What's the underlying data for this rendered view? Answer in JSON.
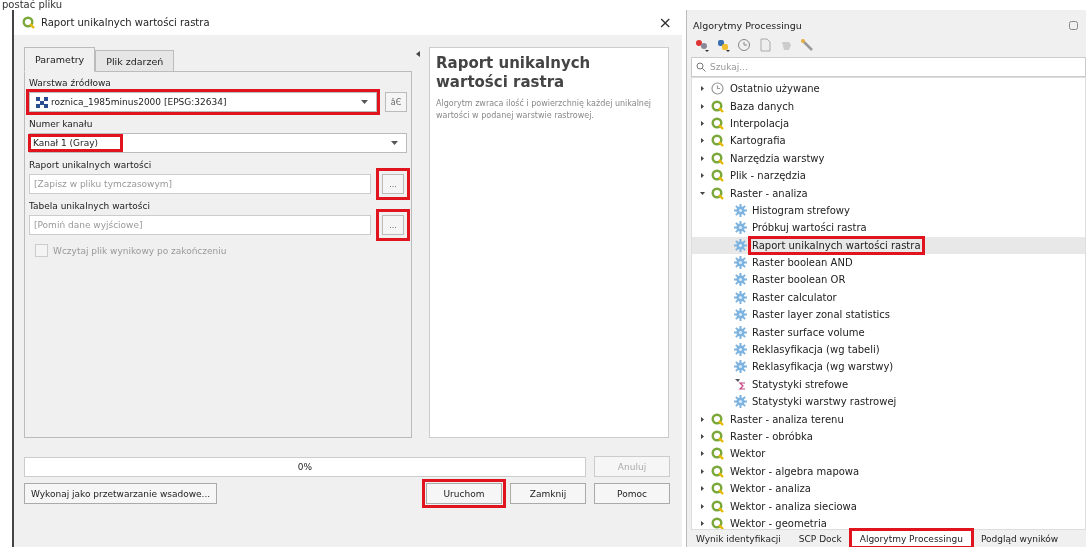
{
  "caption": "postać pliku",
  "dialog": {
    "title": "Raport unikalnych wartości rastra",
    "close": "×",
    "tabs": [
      {
        "label": "Parametry",
        "selected": true
      },
      {
        "label": "Plik zdarzeń",
        "selected": false
      }
    ],
    "params": [
      {
        "kind": "layer",
        "label": "Warstwa źródłowa",
        "value": "roznica_1985minus2000 [EPSG:32634]",
        "side_button": "âЄ",
        "highlighted": true
      },
      {
        "kind": "band",
        "label": "Numer kanału",
        "value": "Kanał 1 (Gray)",
        "highlighted": true
      },
      {
        "kind": "file",
        "label": "Raport unikalnych wartości",
        "placeholder": "[Zapisz w pliku tymczasowym]",
        "side_button": "...",
        "highlighted": true
      },
      {
        "kind": "file",
        "label": "Tabela unikalnych wartości",
        "placeholder": "[Pomiń dane wyjściowe]",
        "side_button": "...",
        "highlighted": true
      },
      {
        "kind": "check",
        "label": "Wczytaj plik wynikowy po zakończeniu",
        "checked": false,
        "disabled": true
      }
    ],
    "help": {
      "title": "Raport unikalnych wartości rastra",
      "text": "Algorytm zwraca ilość i powierzchnię każdej unikalnej wartości w podanej warstwie rastrowej."
    },
    "progress": {
      "level": 0,
      "reading": "0%"
    },
    "cancel": {
      "label": "Anuluj",
      "disabled": true
    },
    "batch_button": "Wykonaj jako przetwarzanie wsadowe...",
    "buttons": [
      {
        "label": "Uruchom",
        "highlighted": true
      },
      {
        "label": "Zamknij",
        "highlighted": false
      },
      {
        "label": "Pomoc",
        "highlighted": false
      }
    ]
  },
  "panel": {
    "title": "Algorytmy Processingu",
    "search": {
      "placeholder": "Szukaj..."
    },
    "tree": [
      {
        "label": "Ostatnio używane",
        "kind": "recent",
        "expanded": false
      },
      {
        "label": "Baza danych",
        "kind": "provider",
        "expanded": false
      },
      {
        "label": "Interpolacja",
        "kind": "provider",
        "expanded": false
      },
      {
        "label": "Kartografia",
        "kind": "provider",
        "expanded": false
      },
      {
        "label": "Narzędzia warstwy",
        "kind": "provider",
        "expanded": false
      },
      {
        "label": "Plik - narzędzia",
        "kind": "provider",
        "expanded": false
      },
      {
        "label": "Raster - analiza",
        "kind": "provider",
        "expanded": true,
        "children": [
          {
            "label": "Histogram strefowy",
            "kind": "algorithm",
            "selected": false
          },
          {
            "label": "Próbkuj wartości rastra",
            "kind": "algorithm",
            "selected": false
          },
          {
            "label": "Raport unikalnych wartości rastra",
            "kind": "algorithm",
            "selected": true,
            "highlighted": true
          },
          {
            "label": "Raster boolean AND",
            "kind": "algorithm",
            "selected": false
          },
          {
            "label": "Raster boolean OR",
            "kind": "algorithm",
            "selected": false
          },
          {
            "label": "Raster calculator",
            "kind": "algorithm",
            "selected": false
          },
          {
            "label": "Raster layer zonal statistics",
            "kind": "algorithm",
            "selected": false
          },
          {
            "label": "Raster surface volume",
            "kind": "algorithm",
            "selected": false
          },
          {
            "label": "Reklasyfikacja (wg tabeli)",
            "kind": "algorithm",
            "selected": false
          },
          {
            "label": "Reklasyfikacja (wg warstwy)",
            "kind": "algorithm",
            "selected": false
          },
          {
            "label": "Statystyki strefowe",
            "kind": "statistics",
            "selected": false
          },
          {
            "label": "Statystyki warstwy rastrowej",
            "kind": "algorithm",
            "selected": false
          }
        ]
      },
      {
        "label": "Raster - analiza terenu",
        "kind": "provider",
        "expanded": false
      },
      {
        "label": "Raster - obróbka",
        "kind": "provider",
        "expanded": false
      },
      {
        "label": "Wektor",
        "kind": "provider",
        "expanded": false
      },
      {
        "label": "Wektor - algebra mapowa",
        "kind": "provider",
        "expanded": false
      },
      {
        "label": "Wektor - analiza",
        "kind": "provider",
        "expanded": false
      },
      {
        "label": "Wektor - analiza sieciowa",
        "kind": "provider",
        "expanded": false
      },
      {
        "label": "Wektor - geometria",
        "kind": "provider",
        "expanded": false
      }
    ],
    "bottom_tabs": [
      {
        "label": "Wynik identyfikacji",
        "selected": false,
        "highlighted": false
      },
      {
        "label": "SCP Dock",
        "selected": false,
        "highlighted": false
      },
      {
        "label": "Algorytmy Processingu",
        "selected": true,
        "highlighted": true
      },
      {
        "label": "Podgląd wyników",
        "selected": false,
        "highlighted": false
      }
    ]
  }
}
